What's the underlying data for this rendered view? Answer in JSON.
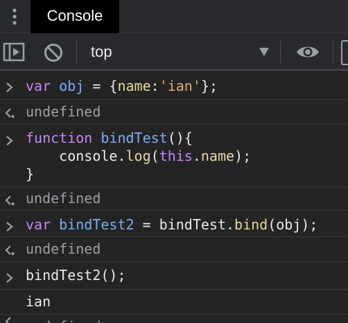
{
  "tabs": [
    {
      "label": "Console",
      "active": true
    }
  ],
  "toolbar": {
    "context": "top",
    "icons": [
      "sidebar-toggle-icon",
      "clear-console-icon",
      "dropdown-arrow-icon",
      "live-expression-eye-icon"
    ]
  },
  "console": {
    "entries": [
      {
        "type": "input",
        "lines": [
          [
            {
              "t": "kw",
              "v": "var"
            },
            {
              "t": "plain",
              "v": " "
            },
            {
              "t": "fn",
              "v": "obj"
            },
            {
              "t": "plain",
              "v": " = {"
            },
            {
              "t": "prop",
              "v": "name"
            },
            {
              "t": "plain",
              "v": ":"
            },
            {
              "t": "str",
              "v": "'ian'"
            },
            {
              "t": "plain",
              "v": "};"
            }
          ]
        ]
      },
      {
        "type": "result",
        "lines": [
          [
            {
              "t": "dim",
              "v": "undefined"
            }
          ]
        ]
      },
      {
        "type": "input",
        "lines": [
          [
            {
              "t": "kw",
              "v": "function"
            },
            {
              "t": "plain",
              "v": " "
            },
            {
              "t": "fn",
              "v": "bindTest"
            },
            {
              "t": "plain",
              "v": "(){"
            }
          ],
          [
            {
              "t": "plain",
              "v": "    console."
            },
            {
              "t": "prop",
              "v": "log"
            },
            {
              "t": "plain",
              "v": "("
            },
            {
              "t": "kw",
              "v": "this"
            },
            {
              "t": "plain",
              "v": "."
            },
            {
              "t": "prop",
              "v": "name"
            },
            {
              "t": "plain",
              "v": ");"
            }
          ],
          [
            {
              "t": "plain",
              "v": "}"
            }
          ]
        ]
      },
      {
        "type": "result",
        "lines": [
          [
            {
              "t": "dim",
              "v": "undefined"
            }
          ]
        ]
      },
      {
        "type": "input",
        "lines": [
          [
            {
              "t": "kw",
              "v": "var"
            },
            {
              "t": "plain",
              "v": " "
            },
            {
              "t": "fn",
              "v": "bindTest2"
            },
            {
              "t": "plain",
              "v": " = bindTest."
            },
            {
              "t": "prop",
              "v": "bind"
            },
            {
              "t": "plain",
              "v": "(obj);"
            }
          ]
        ]
      },
      {
        "type": "result",
        "lines": [
          [
            {
              "t": "dim",
              "v": "undefined"
            }
          ]
        ]
      },
      {
        "type": "input",
        "lines": [
          [
            {
              "t": "plain",
              "v": "bindTest2();"
            }
          ]
        ]
      },
      {
        "type": "log",
        "lines": [
          [
            {
              "t": "plain",
              "v": "ian"
            }
          ]
        ]
      },
      {
        "type": "result",
        "lines": [
          [
            {
              "t": "dim",
              "v": "undefined"
            }
          ]
        ]
      }
    ]
  },
  "colors": {
    "keyword": "#c58af9",
    "function_name": "#7cacf8",
    "string": "#e3a96b",
    "property": "#e8d7a0",
    "text": "#e8eaed",
    "dim": "#9aa0a6",
    "background": "#242424",
    "toolbar": "#292a2d",
    "active_tab": "#000000"
  }
}
